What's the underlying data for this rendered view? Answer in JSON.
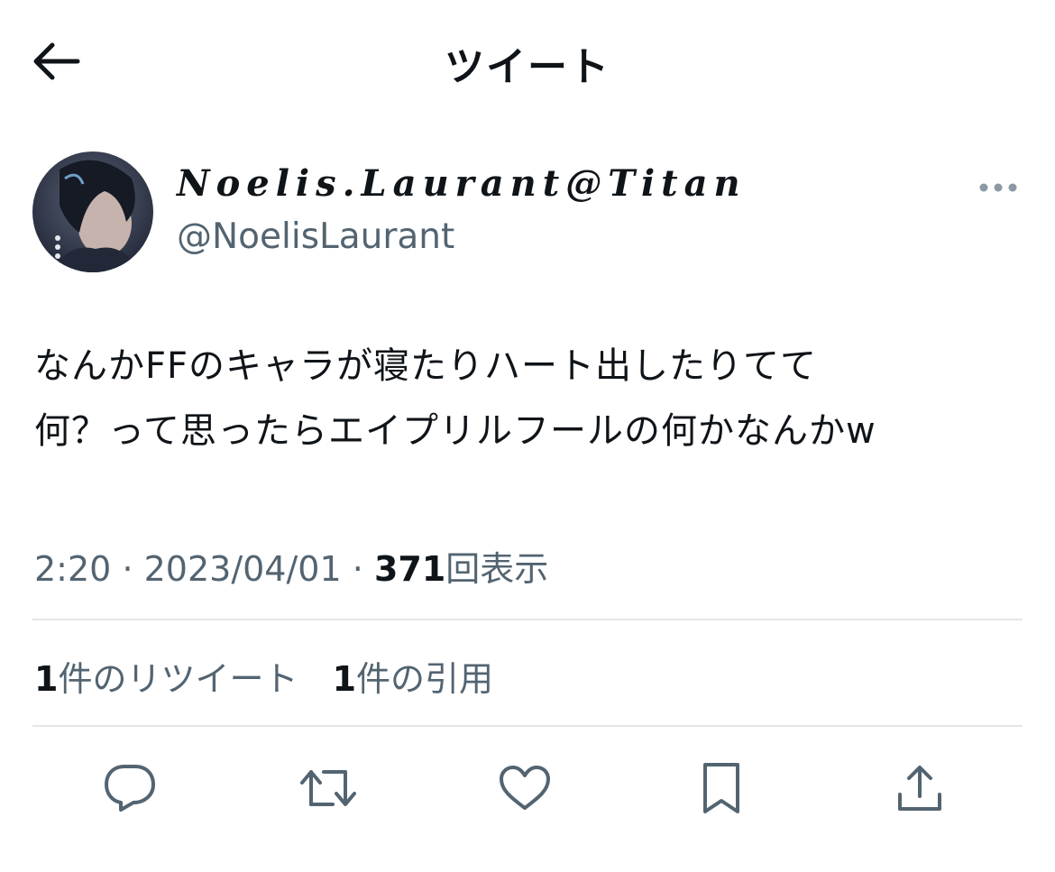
{
  "header": {
    "title": "ツイート"
  },
  "author": {
    "display_name": "Noelis.Laurant@Titan",
    "handle": "@NoelisLaurant"
  },
  "tweet": {
    "lines": [
      "なんかFFのキャラが寝たりハート出したりてて",
      "何？って思ったらエイプリルフールの何かなんかw"
    ],
    "time": "2:20",
    "separator": "·",
    "date": "2023/04/01",
    "views_count": "371",
    "views_label": "回表示"
  },
  "stats": {
    "retweets_count": "1",
    "retweets_label": "件のリツイート",
    "quotes_count": "1",
    "quotes_label": "件の引用"
  },
  "icons": {
    "back": "arrow-left-icon",
    "more": "more-horizontal-icon",
    "reply": "reply-icon",
    "retweet": "retweet-icon",
    "like": "heart-icon",
    "bookmark": "bookmark-icon",
    "share": "share-icon"
  },
  "colors": {
    "text": "#0f1419",
    "secondary": "#536471",
    "divider": "#e1e6ea"
  }
}
